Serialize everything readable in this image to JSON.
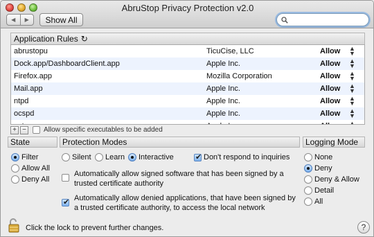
{
  "window": {
    "title": "AbruStop Privacy Protection v2.0"
  },
  "toolbar": {
    "back_glyph": "◀",
    "forward_glyph": "▶",
    "show_all_label": "Show All",
    "search_placeholder": "",
    "search_value": ""
  },
  "rules": {
    "header": "Application Rules",
    "refresh_glyph": "↻",
    "rows": [
      {
        "name": "abrustopu",
        "vendor": "TicuCise, LLC",
        "action": "Allow"
      },
      {
        "name": "Dock.app/DashboardClient.app",
        "vendor": "Apple Inc.",
        "action": "Allow"
      },
      {
        "name": "Firefox.app",
        "vendor": "Mozilla Corporation",
        "action": "Allow"
      },
      {
        "name": "Mail.app",
        "vendor": "Apple Inc.",
        "action": "Allow"
      },
      {
        "name": "ntpd",
        "vendor": "Apple Inc.",
        "action": "Allow"
      },
      {
        "name": "ocspd",
        "vendor": "Apple Inc.",
        "action": "Allow"
      },
      {
        "name": "sntp",
        "vendor": "Apple Inc.",
        "action": "Allow"
      }
    ],
    "stepper_glyph": "▲▼",
    "add_glyph": "+",
    "remove_glyph": "−",
    "allow_specific_label": "Allow specific executables to be added",
    "allow_specific_checked": false
  },
  "state": {
    "header": "State",
    "options": [
      "Filter",
      "Allow All",
      "Deny All"
    ],
    "selected": "Filter"
  },
  "protection": {
    "header": "Protection Modes",
    "options": [
      "Silent",
      "Learn",
      "Interactive"
    ],
    "selected": "Interactive",
    "dont_respond_label": "Don't respond to inquiries",
    "dont_respond_checked": true,
    "auto_signed_label": "Automatically allow signed software that has been signed by a trusted certificate authority",
    "auto_signed_checked": false,
    "auto_denied_label": "Automatically allow denied applications, that have been signed by a trusted certificate authority, to access the local network",
    "auto_denied_checked": true
  },
  "logging": {
    "header": "Logging Mode",
    "options": [
      "None",
      "Deny",
      "Deny & Allow",
      "Detail",
      "All"
    ],
    "selected": "Deny"
  },
  "footer": {
    "lock_text": "Click the lock to prevent further changes.",
    "help_glyph": "?"
  },
  "colors": {
    "zebra": "#edf3fe",
    "focus_ring": "#64a0e6"
  }
}
